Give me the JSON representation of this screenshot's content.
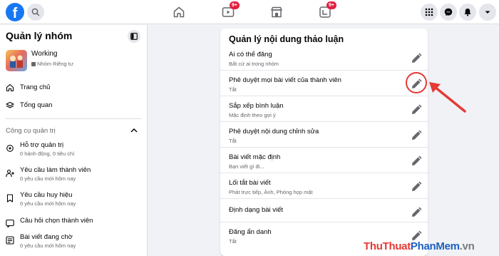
{
  "brand": {
    "logo_letter": "f",
    "accent": "#1877f2"
  },
  "topbar": {
    "nav": [
      {
        "icon": "home-icon",
        "badge": ""
      },
      {
        "icon": "watch-icon",
        "badge": "9+"
      },
      {
        "icon": "marketplace-icon",
        "badge": ""
      },
      {
        "icon": "gaming-icon",
        "badge": "9+"
      }
    ],
    "right_buttons": [
      "menu-grid-icon",
      "messenger-icon",
      "notifications-icon",
      "account-icon"
    ]
  },
  "sidebar": {
    "title": "Quản lý nhóm",
    "group": {
      "name": "Working",
      "privacy": "Nhóm Riêng tư"
    },
    "items": [
      {
        "label": "Trang chủ",
        "icon": "home-icon"
      },
      {
        "label": "Tổng quan",
        "icon": "layers-icon"
      }
    ],
    "section_title": "Công cụ quản trị",
    "tools": [
      {
        "title": "Hỗ trợ quản trị",
        "sub": "0 hành động, 0 tiêu chí",
        "icon": "gear-icon"
      },
      {
        "title": "Yêu cầu làm thành viên",
        "sub": "0 yêu cầu mới hôm nay",
        "icon": "add-person-icon"
      },
      {
        "title": "Yêu cầu huy hiệu",
        "sub": "0 yêu cầu mới hôm nay",
        "icon": "badge-icon"
      },
      {
        "title": "Câu hỏi chọn thành viên",
        "sub": "",
        "icon": "question-icon"
      },
      {
        "title": "Bài viết đang chờ",
        "sub": "0 yêu cầu mới hôm nay",
        "icon": "pending-posts-icon"
      }
    ]
  },
  "main": {
    "title": "Quản lý nội dung thảo luận",
    "rows": [
      {
        "title": "Ai có thể đăng",
        "sub": "Bất cứ ai trong nhóm"
      },
      {
        "title": "Phê duyệt mọi bài viết của thành viên",
        "sub": "Tắt"
      },
      {
        "title": "Sắp xếp bình luận",
        "sub": "Mặc định theo gợi ý"
      },
      {
        "title": "Phê duyệt nội dung chỉnh sửa",
        "sub": "Tắt"
      },
      {
        "title": "Bài viết mặc định",
        "sub": "Bạn viết gì đi..."
      },
      {
        "title": "Lối tắt bài viết",
        "sub": "Phát trực tiếp, Ảnh, Phòng họp mặt"
      },
      {
        "title": "Định dạng bài viết",
        "sub": ""
      },
      {
        "title": "Đăng ẩn danh",
        "sub": "Tắt"
      }
    ]
  },
  "annotation": {
    "color": "#e53935"
  },
  "watermark": {
    "part1": "Thu",
    "part2": "Thuat",
    "part3": "PhanMem",
    "part4": ".vn"
  }
}
